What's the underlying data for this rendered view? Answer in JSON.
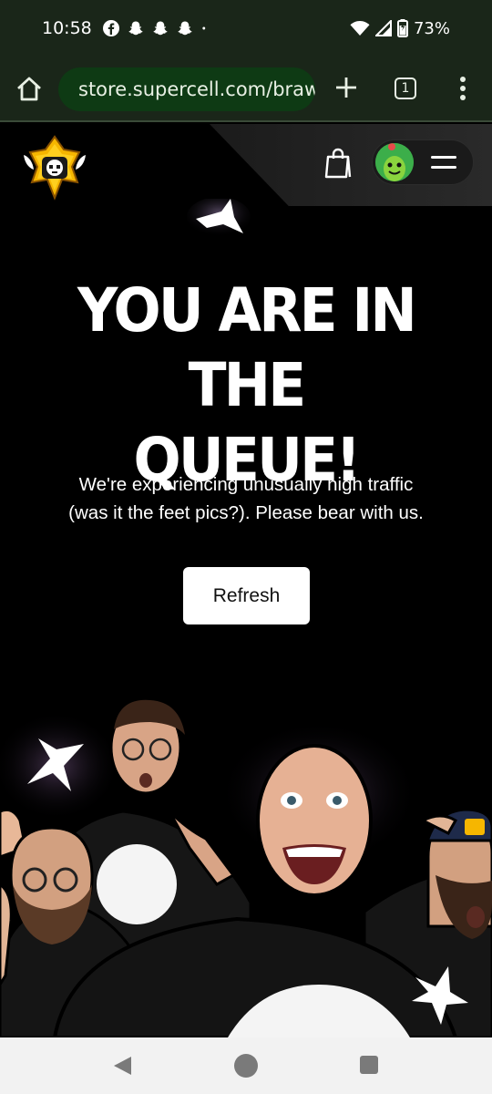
{
  "status_bar": {
    "time": "10:58",
    "notification_icons": [
      "facebook-icon",
      "snapchat-icon",
      "snapchat-icon",
      "snapchat-icon",
      "dot-icon"
    ],
    "battery": "73%"
  },
  "browser": {
    "url": "store.supercell.com/brawlstars",
    "tab_count": "1"
  },
  "header": {
    "logo": "brawl-stars-logo",
    "bag_icon": "shopping-bag-icon",
    "menu_icon": "hamburger-icon"
  },
  "hero": {
    "headline_line1": "YOU ARE IN THE",
    "headline_line2": "QUEUE!",
    "subtitle_line1": "We're experiencing unusually high traffic",
    "subtitle_line2": "(was it the feet pics?). Please bear with us.",
    "refresh_label": "Refresh"
  },
  "colors": {
    "background": "#000000",
    "browser_chrome": "#1a2619",
    "url_pill": "#0e3a14",
    "button": "#ffffff"
  }
}
